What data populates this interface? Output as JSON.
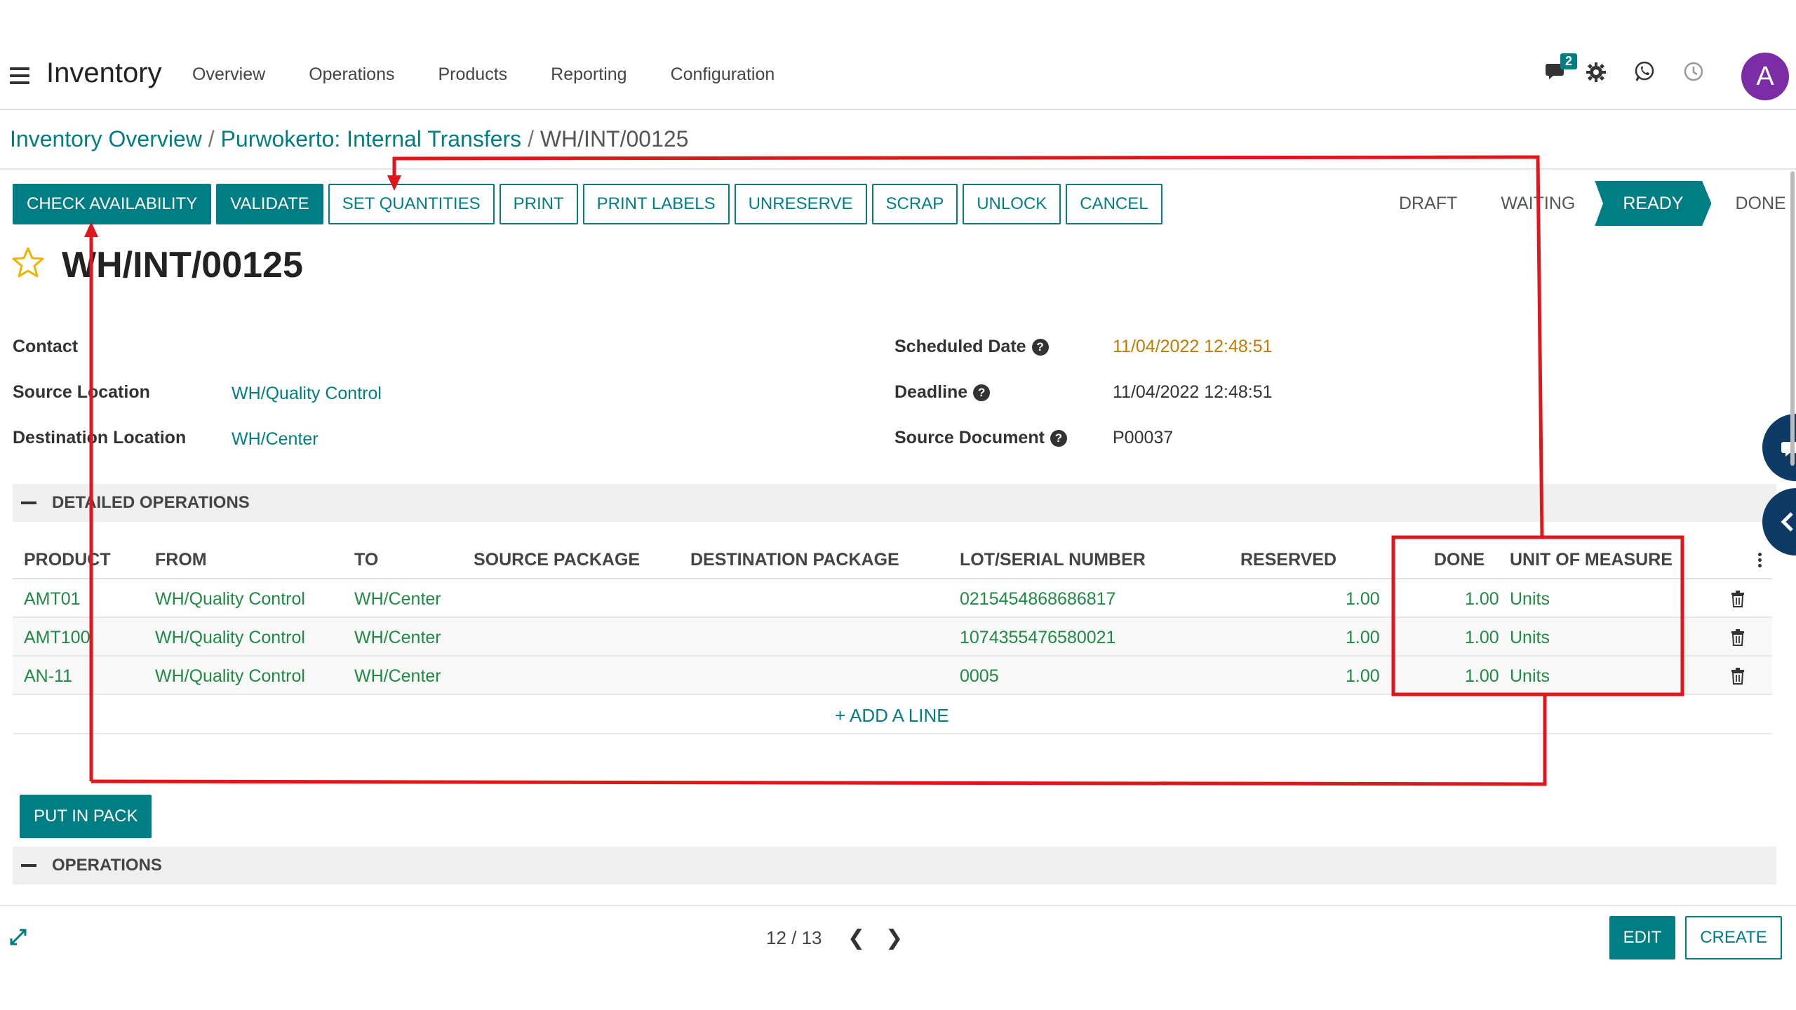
{
  "app": {
    "title": "Inventory",
    "menu": [
      "Overview",
      "Operations",
      "Products",
      "Reporting",
      "Configuration"
    ],
    "chat_badge": "2",
    "avatar_letter": "A"
  },
  "breadcrumb": {
    "items": [
      "Inventory Overview",
      "Purwokerto: Internal Transfers"
    ],
    "current": "WH/INT/00125",
    "sep": "/"
  },
  "controls": {
    "buttons": [
      "CHECK AVAILABILITY",
      "VALIDATE",
      "SET QUANTITIES",
      "PRINT",
      "PRINT LABELS",
      "UNRESERVE",
      "SCRAP",
      "UNLOCK",
      "CANCEL"
    ]
  },
  "status": {
    "stages": [
      "DRAFT",
      "WAITING",
      "READY",
      "DONE"
    ],
    "active": "READY"
  },
  "record": {
    "title": "WH/INT/00125"
  },
  "fields": {
    "contact_label": "Contact",
    "source_location_label": "Source Location",
    "source_location_value": "WH/Quality Control",
    "destination_location_label": "Destination Location",
    "destination_location_value": "WH/Center",
    "scheduled_date_label": "Scheduled Date",
    "scheduled_date_value": "11/04/2022 12:48:51",
    "deadline_label": "Deadline",
    "deadline_value": "11/04/2022 12:48:51",
    "source_document_label": "Source Document",
    "source_document_value": "P00037",
    "help_glyph": "?"
  },
  "sections": {
    "detailed": "DETAILED OPERATIONS",
    "operations": "OPERATIONS"
  },
  "table": {
    "headers": [
      "PRODUCT",
      "FROM",
      "TO",
      "SOURCE PACKAGE",
      "DESTINATION PACKAGE",
      "LOT/SERIAL NUMBER",
      "RESERVED",
      "DONE",
      "UNIT OF MEASURE"
    ],
    "rows": [
      {
        "product": "AMT01",
        "from": "WH/Quality Control",
        "to": "WH/Center",
        "lot": "0215454868686817",
        "reserved": "1.00",
        "done": "1.00",
        "uom": "Units"
      },
      {
        "product": "AMT100",
        "from": "WH/Quality Control",
        "to": "WH/Center",
        "lot": "1074355476580021",
        "reserved": "1.00",
        "done": "1.00",
        "uom": "Units"
      },
      {
        "product": "AN-11",
        "from": "WH/Quality Control",
        "to": "WH/Center",
        "lot": "0005",
        "reserved": "1.00",
        "done": "1.00",
        "uom": "Units"
      }
    ],
    "add_line": "+ ADD A LINE"
  },
  "put_in_pack": "PUT IN PACK",
  "footer": {
    "pager": "12 / 13",
    "prev_glyph": "❮",
    "next_glyph": "❯",
    "edit": "EDIT",
    "create": "CREATE"
  },
  "colors": {
    "primary": "#017e84",
    "link_green": "#1f8a43",
    "annotation": "#e0161b",
    "avatar": "#7c2ca5"
  }
}
